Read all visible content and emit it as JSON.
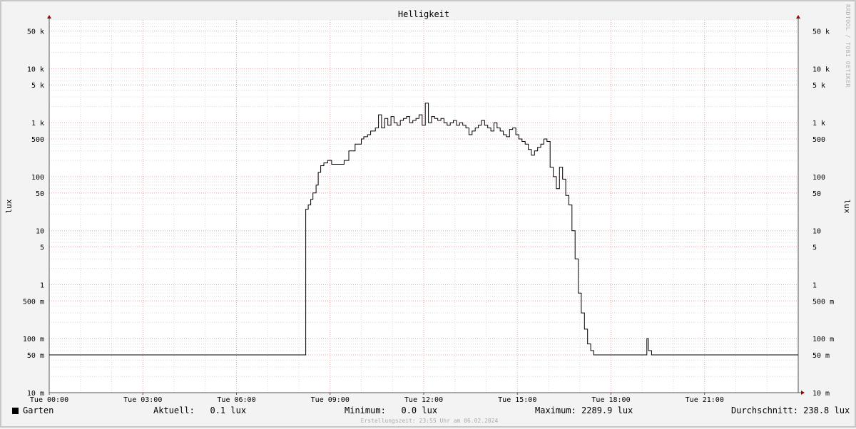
{
  "chart_data": {
    "type": "line",
    "title": "Helligkeit",
    "ylabel": "lux",
    "yscale": "log",
    "ylim": [
      0.01,
      80000
    ],
    "xlim": [
      0,
      24
    ],
    "y_ticks": [
      {
        "value": 50000,
        "label": "50 k"
      },
      {
        "value": 10000,
        "label": "10 k"
      },
      {
        "value": 5000,
        "label": "5 k"
      },
      {
        "value": 1000,
        "label": "1 k"
      },
      {
        "value": 500,
        "label": "500"
      },
      {
        "value": 100,
        "label": "100"
      },
      {
        "value": 50,
        "label": "50"
      },
      {
        "value": 10,
        "label": "10"
      },
      {
        "value": 5,
        "label": "5"
      },
      {
        "value": 1,
        "label": "1"
      },
      {
        "value": 0.5,
        "label": "500 m"
      },
      {
        "value": 0.1,
        "label": "100 m"
      },
      {
        "value": 0.05,
        "label": "50 m"
      },
      {
        "value": 0.01,
        "label": "10 m"
      }
    ],
    "x_ticks": [
      {
        "value": 0,
        "label": "Tue 00:00"
      },
      {
        "value": 3,
        "label": "Tue 03:00"
      },
      {
        "value": 6,
        "label": "Tue 06:00"
      },
      {
        "value": 9,
        "label": "Tue 09:00"
      },
      {
        "value": 12,
        "label": "Tue 12:00"
      },
      {
        "value": 15,
        "label": "Tue 15:00"
      },
      {
        "value": 18,
        "label": "Tue 18:00"
      },
      {
        "value": 21,
        "label": "Tue 21:00"
      }
    ],
    "grid": true,
    "series": [
      {
        "name": "Garten",
        "color": "#000000",
        "x": [
          0,
          8.2,
          8.22,
          8.3,
          8.38,
          8.45,
          8.55,
          8.62,
          8.7,
          8.8,
          8.92,
          9.05,
          9.12,
          9.2,
          9.3,
          9.45,
          9.6,
          9.8,
          10.0,
          10.08,
          10.2,
          10.3,
          10.45,
          10.55,
          10.65,
          10.75,
          10.85,
          10.95,
          11.05,
          11.15,
          11.25,
          11.35,
          11.45,
          11.55,
          11.65,
          11.75,
          11.85,
          11.95,
          12.05,
          12.15,
          12.25,
          12.35,
          12.45,
          12.55,
          12.65,
          12.75,
          12.85,
          12.95,
          13.05,
          13.15,
          13.25,
          13.35,
          13.45,
          13.55,
          13.65,
          13.75,
          13.85,
          13.95,
          14.05,
          14.15,
          14.25,
          14.35,
          14.45,
          14.55,
          14.65,
          14.75,
          14.85,
          14.95,
          15.05,
          15.15,
          15.25,
          15.35,
          15.45,
          15.55,
          15.65,
          15.75,
          15.85,
          15.95,
          16.05,
          16.15,
          16.25,
          16.35,
          16.45,
          16.55,
          16.65,
          16.75,
          16.85,
          16.95,
          17.05,
          17.15,
          17.25,
          17.35,
          17.45,
          17.55,
          17.65,
          17.75,
          17.85,
          17.95,
          18.05,
          18.15,
          18.25,
          18.35,
          18.45,
          19.1,
          19.15,
          19.2,
          19.3,
          24
        ],
        "values": [
          0.05,
          0.05,
          25,
          30,
          38,
          50,
          70,
          120,
          160,
          180,
          200,
          170,
          170,
          170,
          170,
          200,
          300,
          400,
          500,
          550,
          600,
          700,
          800,
          1400,
          800,
          1200,
          900,
          1300,
          1000,
          900,
          1100,
          1200,
          1300,
          1000,
          1100,
          1200,
          1400,
          900,
          2300,
          1000,
          1300,
          1200,
          1100,
          1200,
          1000,
          900,
          1000,
          1100,
          900,
          1000,
          900,
          800,
          600,
          700,
          800,
          900,
          1100,
          900,
          800,
          700,
          1000,
          800,
          700,
          600,
          550,
          750,
          800,
          600,
          500,
          450,
          400,
          320,
          250,
          300,
          350,
          400,
          500,
          450,
          150,
          100,
          60,
          150,
          90,
          45,
          30,
          10,
          3,
          0.7,
          0.3,
          0.15,
          0.08,
          0.06,
          0.05,
          0.05,
          0.05,
          0.05,
          0.05,
          0.05,
          0.05,
          0.05,
          0.05,
          0.05,
          0.05,
          0.05,
          0.1,
          0.06,
          0.05,
          0.05
        ]
      }
    ]
  },
  "legend": {
    "series_name": "Garten",
    "current_label": "Aktuell:",
    "current_value": "0.1 lux",
    "min_label": "Minimum:",
    "min_value": "0.0 lux",
    "max_label": "Maximum:",
    "max_value": "2289.9 lux",
    "avg_label": "Durchschnitt:",
    "avg_value": "238.8 lux"
  },
  "footer": "Erstellungszeit: 23:55 Uhr am 06.02.2024",
  "watermark": "RRDTOOL / TOBI OETIKER"
}
